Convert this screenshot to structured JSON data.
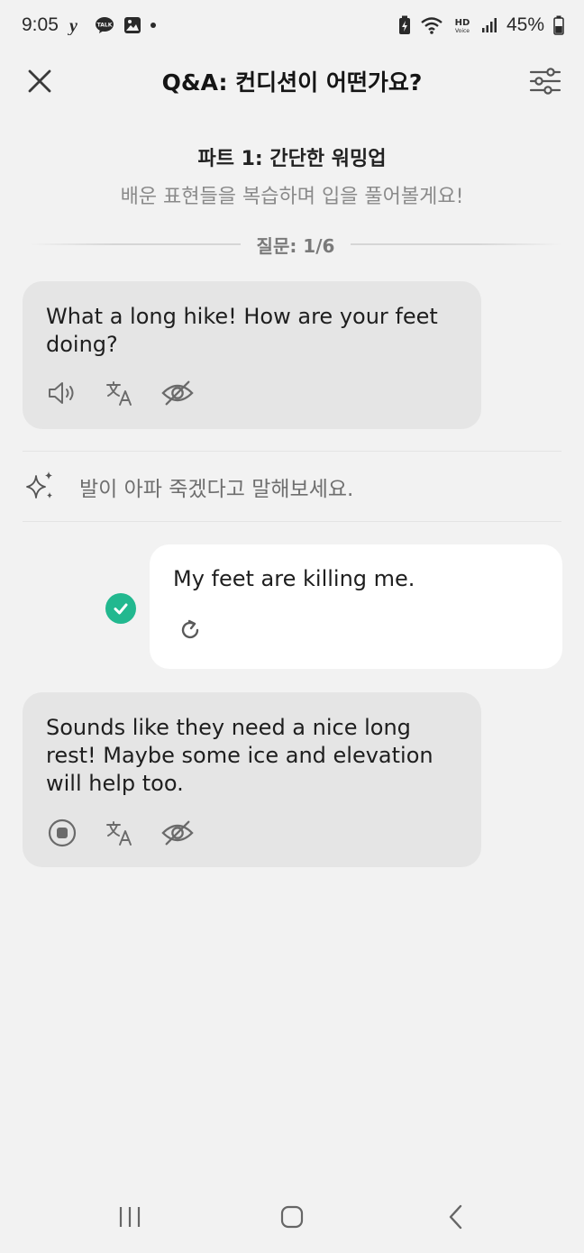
{
  "status_bar": {
    "time": "9:05",
    "battery": "45%",
    "icons": [
      "yahoo-icon",
      "talk-icon",
      "gallery-icon",
      "dot-icon",
      "battery-saver-icon",
      "wifi-icon",
      "hd-voice-icon",
      "signal-icon",
      "battery-icon"
    ]
  },
  "header": {
    "title": "Q&A: 컨디션이 어떤가요?",
    "close_icon": "close-icon",
    "settings_icon": "sliders-icon"
  },
  "part": {
    "title": "파트 1: 간단한 워밍업",
    "subtitle": "배운 표현들을 복습하며 입을 풀어볼게요!",
    "question_progress": "질문: 1/6"
  },
  "messages": {
    "ai_1": {
      "text": "What a long hike! How are your feet doing?",
      "actions": [
        "speaker-icon",
        "translate-icon",
        "hide-icon"
      ]
    },
    "hint": {
      "icon": "sparkles-icon",
      "text": "발이 아파 죽겠다고 말해보세요."
    },
    "user_1": {
      "text": "My feet are killing me.",
      "status_icon": "check-icon",
      "action": "retry-icon"
    },
    "ai_2": {
      "text": "Sounds like they need a nice long rest! Maybe some ice and elevation will help too.",
      "actions": [
        "stop-icon",
        "translate-icon",
        "hide-icon"
      ]
    }
  },
  "nav_bar": {
    "buttons": [
      "recent-apps-icon",
      "home-icon",
      "back-icon"
    ]
  },
  "colors": {
    "background": "#f2f2f2",
    "ai_bubble": "#e5e5e5",
    "user_bubble": "#ffffff",
    "success": "#22b88f"
  }
}
